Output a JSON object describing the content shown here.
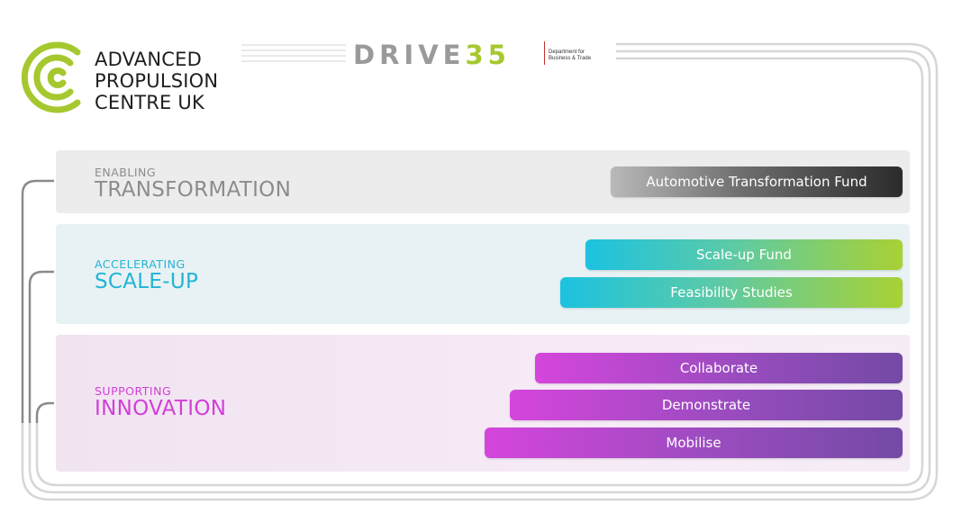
{
  "header": {
    "logo_lines": [
      "ADVANCED",
      "PROPULSION",
      "CENTRE UK"
    ],
    "drive_prefix": "DRIVE",
    "drive_suffix": "35",
    "dept_line1": "Department for",
    "dept_line2": "Business & Trade"
  },
  "tiers": [
    {
      "subtitle": "ENABLING",
      "title": "TRANSFORMATION",
      "color": "#8c8c8c",
      "programmes": [
        "Automotive Transformation Fund"
      ]
    },
    {
      "subtitle": "ACCELERATING",
      "title": "SCALE-UP",
      "color": "#22b3d6",
      "programmes": [
        "Scale-up Fund",
        "Feasibility Studies"
      ]
    },
    {
      "subtitle": "SUPPORTING",
      "title": "INNOVATION",
      "color": "#d23fd8",
      "programmes": [
        "Collaborate",
        "Demonstrate",
        "Mobilise"
      ]
    }
  ],
  "colors": {
    "brand_green": "#a6c82f",
    "transformation_grey": "#8c8c8c",
    "scaleup_cyan": "#22b3d6",
    "innovation_magenta": "#d23fd8",
    "innovation_purple": "#734aa5"
  }
}
